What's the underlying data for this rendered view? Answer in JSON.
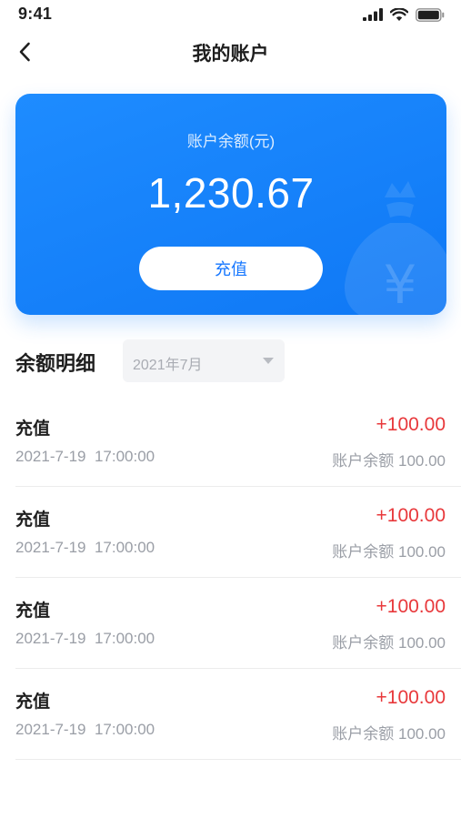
{
  "status_bar": {
    "time": "9:41",
    "icons": [
      "signal-icon",
      "wifi-icon",
      "battery-icon"
    ]
  },
  "nav": {
    "back_icon": "chevron-left-icon",
    "title": "我的账户"
  },
  "balance_card": {
    "label": "账户余额(元)",
    "amount": "1,230.67",
    "recharge_label": "充值",
    "decoration_icon": "money-bag-icon",
    "decoration_symbol": "¥",
    "accent_color": "#1677ff"
  },
  "details": {
    "section_title": "余额明细",
    "month_filter": "2021年7月"
  },
  "transactions": [
    {
      "title": "充值",
      "amount": "+100.00",
      "time": "2021-7-19  17:00:00",
      "balance": "账户余额 100.00"
    },
    {
      "title": "充值",
      "amount": "+100.00",
      "time": "2021-7-19  17:00:00",
      "balance": "账户余额 100.00"
    },
    {
      "title": "充值",
      "amount": "+100.00",
      "time": "2021-7-19  17:00:00",
      "balance": "账户余额 100.00"
    },
    {
      "title": "充值",
      "amount": "+100.00",
      "time": "2021-7-19  17:00:00",
      "balance": "账户余额 100.00"
    }
  ],
  "colors": {
    "positive_amount": "#e8383b",
    "secondary_text": "#9a9ea6"
  }
}
